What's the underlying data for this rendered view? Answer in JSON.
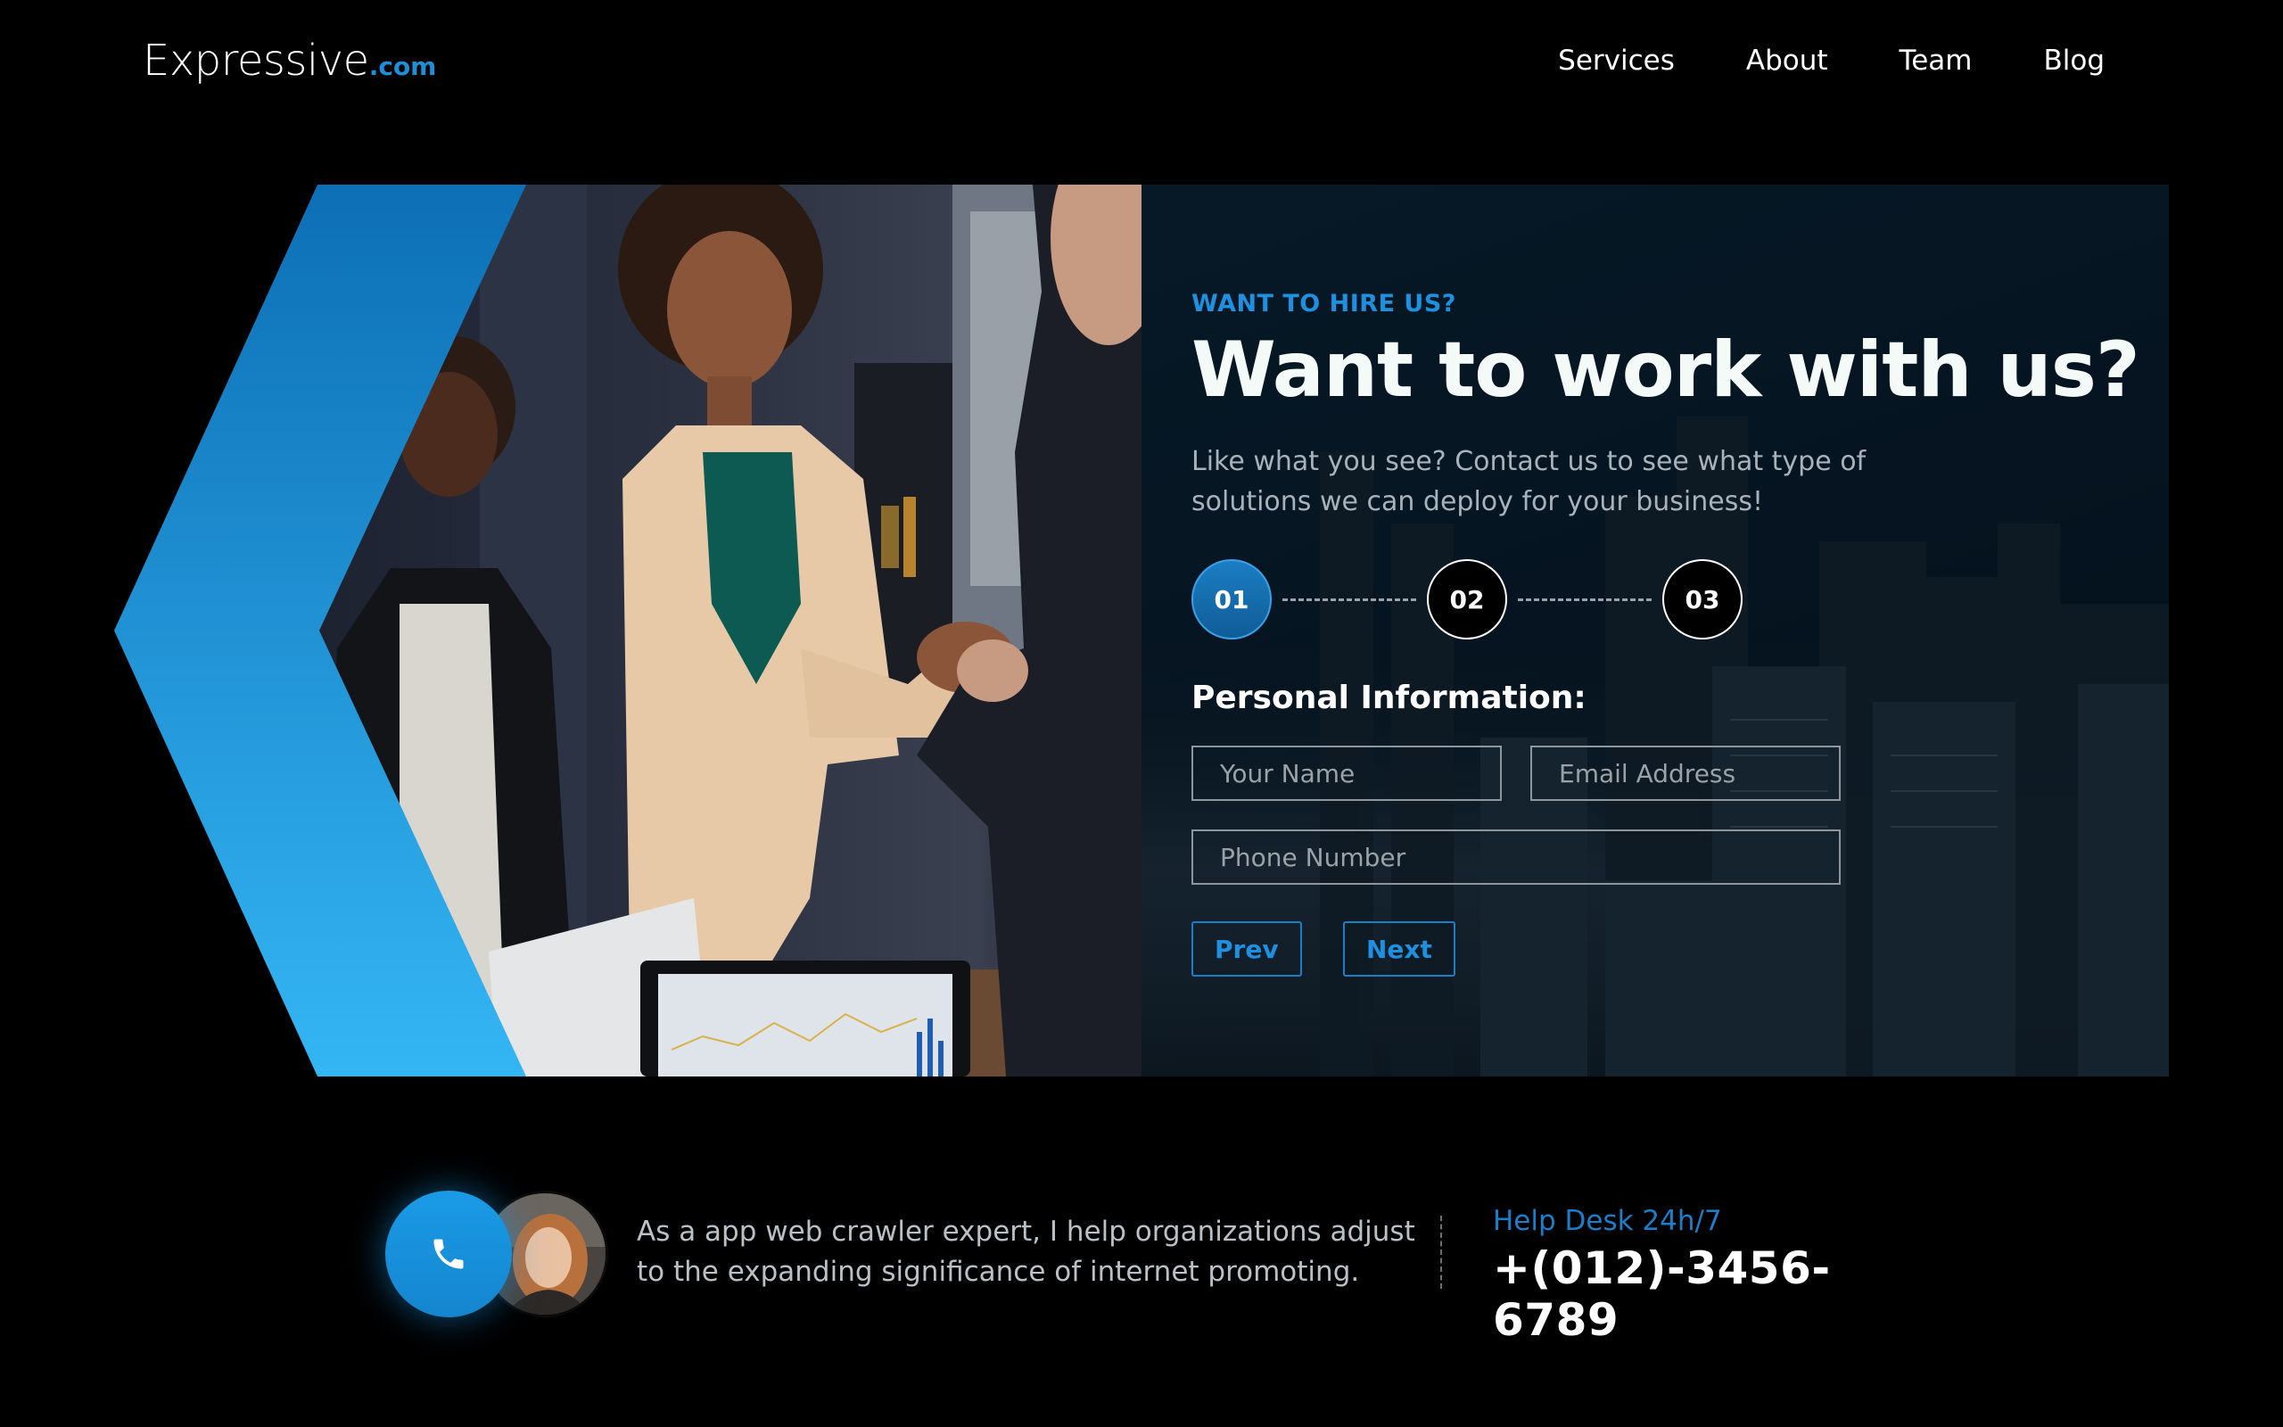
{
  "header": {
    "logo_main": "Expressive",
    "logo_tld": ".com",
    "nav": [
      "Services",
      "About",
      "Team",
      "Blog"
    ]
  },
  "hero": {
    "eyebrow": "WANT TO HIRE US?",
    "title": "Want to work with us?",
    "subtitle": "Like what you see? Contact us to see what type of solutions we can deploy for your business!",
    "steps": [
      {
        "label": "01",
        "active": true
      },
      {
        "label": "02",
        "active": false
      },
      {
        "label": "03",
        "active": false
      }
    ],
    "form": {
      "section_title": "Personal Information:",
      "name_placeholder": "Your Name",
      "email_placeholder": "Email Address",
      "phone_placeholder": "Phone Number",
      "prev_label": "Prev",
      "next_label": "Next"
    }
  },
  "contact": {
    "description": "As a app web crawler expert, I help organizations adjust to the expanding significance of internet promoting.",
    "help_label": "Help Desk 24h/7",
    "phone": "+(012)-3456-6789"
  },
  "colors": {
    "accent": "#1e90df",
    "background": "#000000",
    "panel": "#061724"
  },
  "icons": [
    "phone-icon"
  ]
}
